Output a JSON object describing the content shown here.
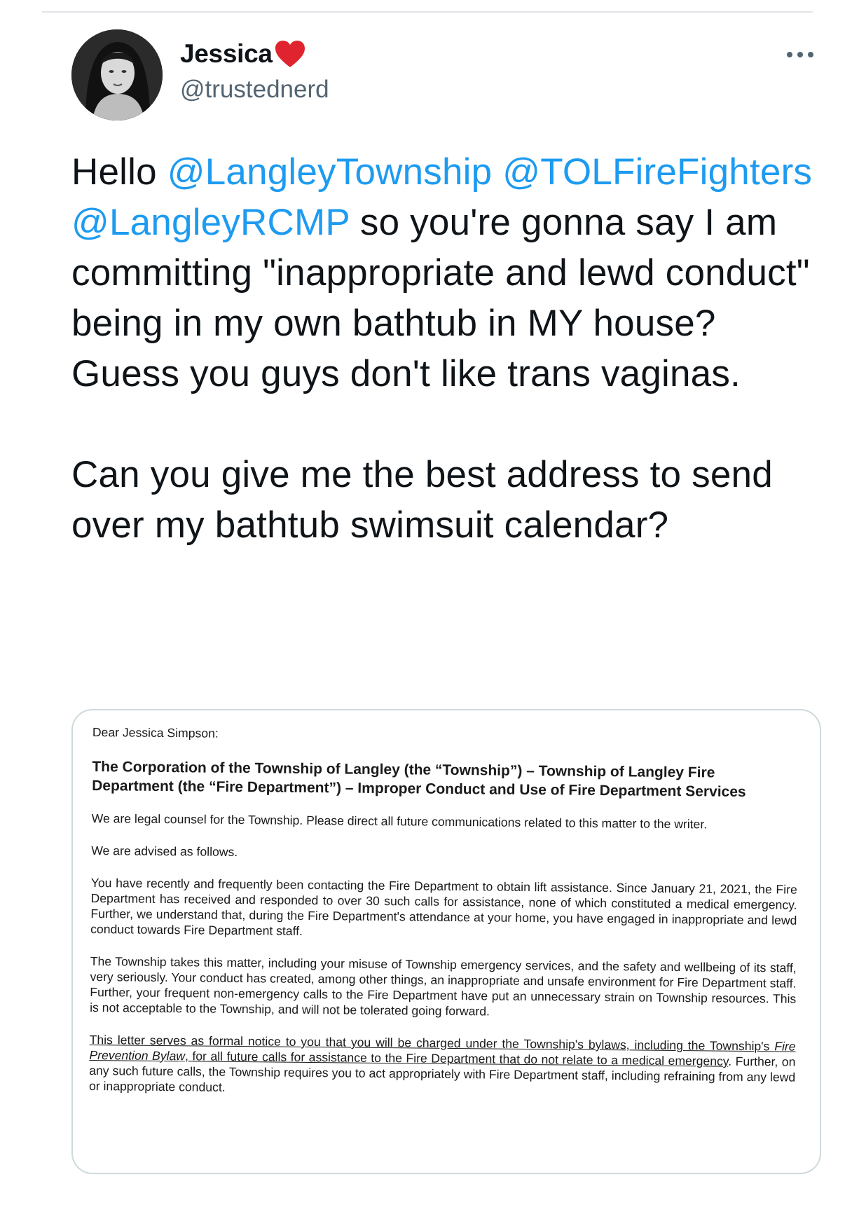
{
  "author": {
    "name": "Jessica",
    "handle": "@trustednerd",
    "name_emoji": "red-heart-icon"
  },
  "colors": {
    "mention": "#1d9bf0",
    "text": "#0f1419",
    "handle": "#536471",
    "heart": "#e0242f",
    "card_border": "#cfd9de"
  },
  "tweet": {
    "p1_pre": "Hello ",
    "mention1": "@LangleyTownship",
    "mention2": "@TOLFireFighters",
    "mention3": "@LangleyRCMP",
    "p1_rest": " so you're gonna say I am committing \"inappropriate and lewd conduct\" being in my own bathtub in MY house? Guess you guys don't like trans vaginas.",
    "p2": "Can you give me the best address to send over my bathtub swimsuit calendar?"
  },
  "letter": {
    "salutation": "Dear Jessica Simpson:",
    "subject": "The Corporation of the Township of Langley (the “Township”) – Township of Langley Fire Department (the “Fire Department”) – Improper Conduct and Use of Fire Department Services",
    "para1": "We are legal counsel for the Township.  Please direct all future communications related to this matter to the writer.",
    "para2": "We are advised as follows.",
    "para3": "You have recently and frequently been contacting the Fire Department to obtain lift assistance. Since January 21, 2021, the Fire Department has received and responded to over 30 such calls for assistance, none of which constituted a medical emergency.  Further, we understand that, during the Fire Department's attendance at your home, you have engaged in inappropriate and lewd conduct towards Fire Department staff.",
    "para4": "The Township takes this matter, including your misuse of Township emergency services, and the safety and wellbeing of its staff, very seriously. Your conduct has created, among other things, an inappropriate and unsafe environment for Fire Department staff. Further, your frequent non-emergency calls to the Fire Department have put an unnecessary strain on Township resources. This is not acceptable to the Township, and will not be tolerated going forward.",
    "para5_u1": "This letter serves as formal notice to you that you will be charged under the Township's bylaws, including the Township's ",
    "para5_u_italic": "Fire Prevention Bylaw",
    "para5_u2": ", for all future calls for assistance to the Fire Department that do not relate to a medical emergency",
    "para5_rest": ".  Further, on any such future calls, the Township requires you to act appropriately with Fire Department staff, including refraining from any lewd or inappropriate conduct."
  }
}
